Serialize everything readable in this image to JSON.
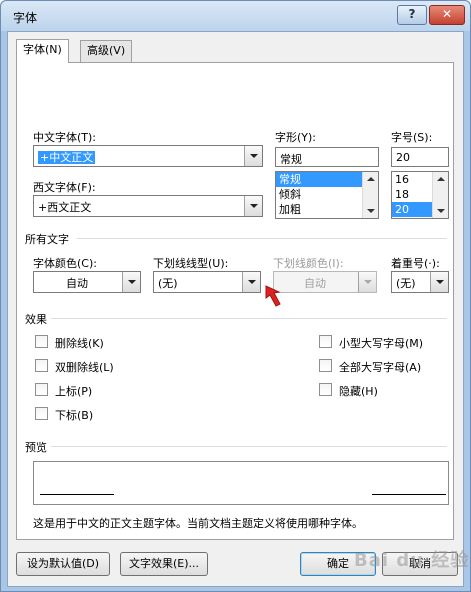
{
  "window": {
    "title": "字体",
    "help": "?",
    "close": "✕"
  },
  "tabs": [
    {
      "label": "字体(N)"
    },
    {
      "label": "高级(V)"
    }
  ],
  "font": {
    "chinese_label": "中文字体(T):",
    "chinese_value": "+中文正文",
    "western_label": "西文字体(F):",
    "western_value": "+西文正文",
    "style_label": "字形(Y):",
    "style_value": "常规",
    "style_options": [
      "常规",
      "倾斜",
      "加粗"
    ],
    "size_label": "字号(S):",
    "size_value": "20",
    "size_options": [
      "16",
      "18",
      "20"
    ]
  },
  "all_text": {
    "section": "所有文字",
    "color_label": "字体颜色(C):",
    "color_value": "自动",
    "underline_label": "下划线线型(U):",
    "underline_value": "(无)",
    "underline_color_label": "下划线颜色(I):",
    "underline_color_value": "自动",
    "emphasis_label": "着重号(·):",
    "emphasis_value": "(无)"
  },
  "effects": {
    "section": "效果",
    "left": [
      "删除线(K)",
      "双删除线(L)",
      "上标(P)",
      "下标(B)"
    ],
    "right": [
      "小型大写字母(M)",
      "全部大写字母(A)",
      "隐藏(H)"
    ]
  },
  "preview": {
    "section": "预览",
    "note": "这是用于中文的正文主题字体。当前文档主题定义将使用哪种字体。"
  },
  "buttons": {
    "set_default": "设为默认值(D)",
    "text_effects": "文字效果(E)...",
    "ok": "确定",
    "cancel": "取消"
  },
  "watermark": "Bai du 经验",
  "colors": {
    "selection": "#3399ff",
    "arrow": "#e02020"
  }
}
